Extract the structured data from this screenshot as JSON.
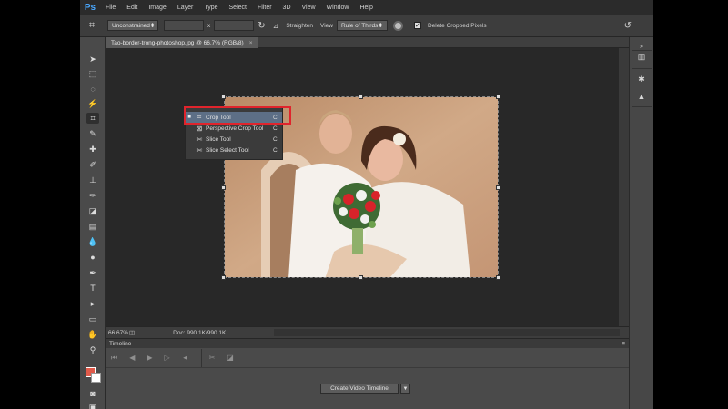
{
  "app": {
    "logo": "Ps",
    "menu": [
      "File",
      "Edit",
      "Image",
      "Layer",
      "Type",
      "Select",
      "Filter",
      "3D",
      "View",
      "Window",
      "Help"
    ]
  },
  "options_bar": {
    "tool_icon": "crop-icon",
    "ratio_select": "Unconstrained",
    "swap_label": "x",
    "straighten_label": "Straighten",
    "view_label": "View",
    "view_select": "Rule of Thirds",
    "delete_cropped_label": "Delete Cropped Pixels",
    "delete_cropped_checked": true
  },
  "document": {
    "tab_title": "Tao-border-trong-photoshop.jpg @ 66.7% (RGB/8)",
    "close_glyph": "×"
  },
  "status": {
    "zoom": "66.67%",
    "doc_size": "Doc: 990.1K/990.1K"
  },
  "timeline": {
    "label": "Timeline",
    "create_button": "Create Video Timeline"
  },
  "crop_flyout": {
    "items": [
      {
        "label": "Crop Tool",
        "shortcut": "C",
        "icon": "crop-icon",
        "selected": true
      },
      {
        "label": "Perspective Crop Tool",
        "shortcut": "C",
        "icon": "perspective-crop-icon",
        "selected": false
      },
      {
        "label": "Slice Tool",
        "shortcut": "C",
        "icon": "slice-icon",
        "selected": false
      },
      {
        "label": "Slice Select Tool",
        "shortcut": "C",
        "icon": "slice-select-icon",
        "selected": false
      }
    ]
  },
  "colors": {
    "foreground": "#e05a4a",
    "background": "#ffffff",
    "highlight": "#e0242c"
  }
}
